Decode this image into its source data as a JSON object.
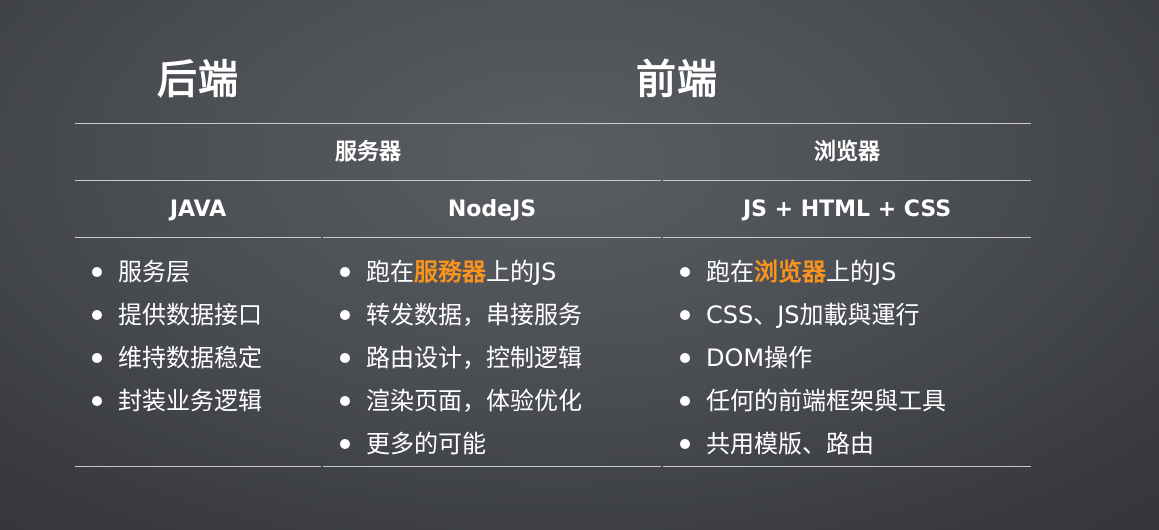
{
  "columns": {
    "backend_title": "后端",
    "frontend_title": "前端"
  },
  "rows": {
    "server_label": "服务器",
    "browser_label": "浏览器",
    "java_label": "JAVA",
    "node_label": "NodeJS",
    "web_label": "JS + HTML + CSS"
  },
  "lists": {
    "java": [
      "服务层",
      "提供数据接口",
      "维持数据稳定",
      "封装业务逻辑"
    ],
    "node": {
      "first": {
        "before": "跑在",
        "highlight": "服務器",
        "after": "上的JS"
      },
      "items": [
        "转发数据，串接服务",
        "路由设计，控制逻辑",
        "渲染页面，体验优化",
        "更多的可能"
      ]
    },
    "web": {
      "first": {
        "before": "跑在",
        "highlight": "浏览器",
        "after": "上的JS"
      },
      "items": [
        "CSS、JS加載與運行",
        "DOM操作",
        "任何的前端框架與工具",
        "共用模版、路由"
      ]
    }
  },
  "colors": {
    "highlight": "#f7931e",
    "text": "#ffffff",
    "rule": "#c9c9c9"
  }
}
